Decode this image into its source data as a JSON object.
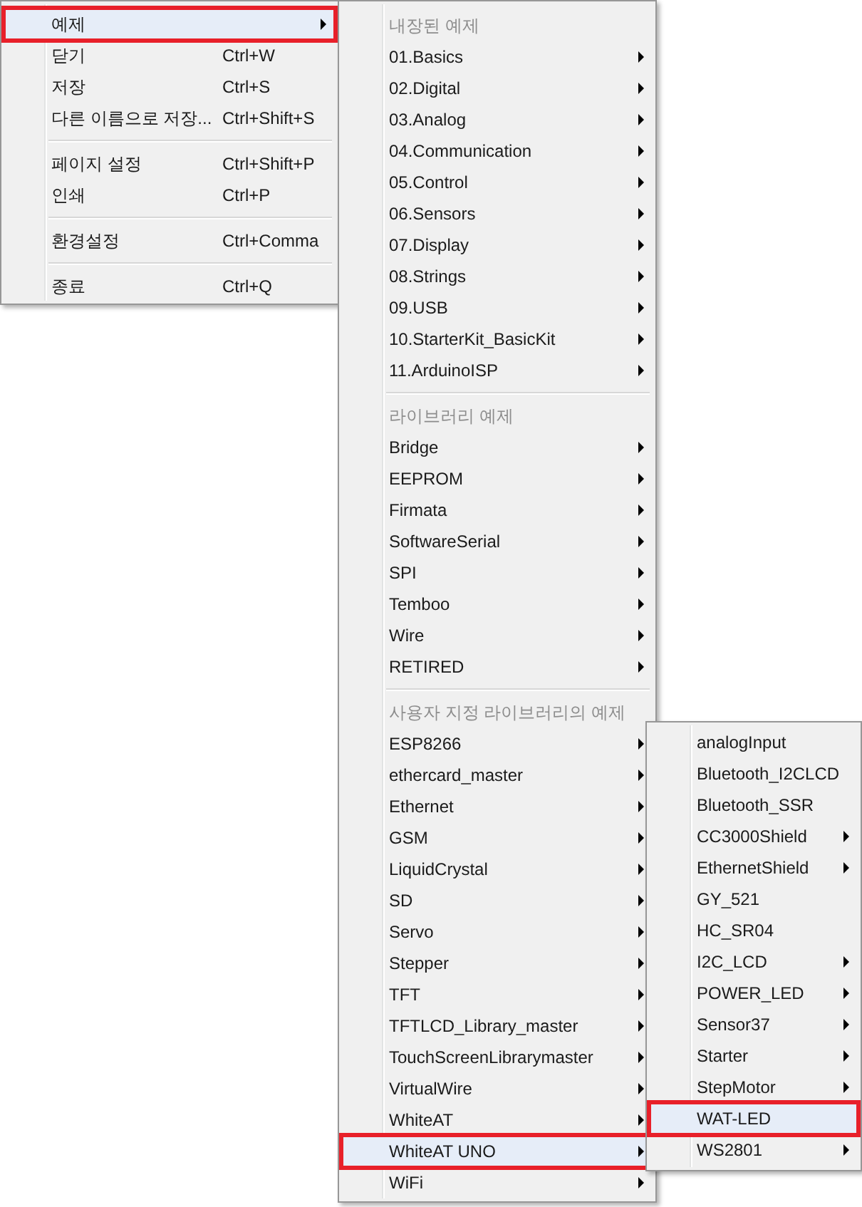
{
  "menus": [
    {
      "items": [
        {
          "kind": "item",
          "label": "예제",
          "submenu": true,
          "selected": true
        },
        {
          "kind": "item",
          "label": "닫기",
          "shortcut": "Ctrl+W",
          "selected": false
        },
        {
          "kind": "item",
          "label": "저장",
          "shortcut": "Ctrl+S",
          "selected": false
        },
        {
          "kind": "item",
          "label": "다른 이름으로 저장...",
          "shortcut": "Ctrl+Shift+S",
          "selected": false
        },
        {
          "kind": "separator"
        },
        {
          "kind": "item",
          "label": "페이지 설정",
          "shortcut": "Ctrl+Shift+P",
          "selected": false
        },
        {
          "kind": "item",
          "label": "인쇄",
          "shortcut": "Ctrl+P",
          "selected": false
        },
        {
          "kind": "separator"
        },
        {
          "kind": "item",
          "label": "환경설정",
          "shortcut": "Ctrl+Comma",
          "selected": false
        },
        {
          "kind": "separator"
        },
        {
          "kind": "item",
          "label": "종료",
          "shortcut": "Ctrl+Q",
          "selected": false
        }
      ]
    },
    {
      "items": [
        {
          "kind": "header",
          "label": "내장된 예제"
        },
        {
          "kind": "item",
          "label": "01.Basics",
          "submenu": true,
          "selected": false
        },
        {
          "kind": "item",
          "label": "02.Digital",
          "submenu": true,
          "selected": false
        },
        {
          "kind": "item",
          "label": "03.Analog",
          "submenu": true,
          "selected": false
        },
        {
          "kind": "item",
          "label": "04.Communication",
          "submenu": true,
          "selected": false
        },
        {
          "kind": "item",
          "label": "05.Control",
          "submenu": true,
          "selected": false
        },
        {
          "kind": "item",
          "label": "06.Sensors",
          "submenu": true,
          "selected": false
        },
        {
          "kind": "item",
          "label": "07.Display",
          "submenu": true,
          "selected": false
        },
        {
          "kind": "item",
          "label": "08.Strings",
          "submenu": true,
          "selected": false
        },
        {
          "kind": "item",
          "label": "09.USB",
          "submenu": true,
          "selected": false
        },
        {
          "kind": "item",
          "label": "10.StarterKit_BasicKit",
          "submenu": true,
          "selected": false
        },
        {
          "kind": "item",
          "label": "11.ArduinoISP",
          "submenu": true,
          "selected": false
        },
        {
          "kind": "separator"
        },
        {
          "kind": "header",
          "label": "라이브러리 예제"
        },
        {
          "kind": "item",
          "label": "Bridge",
          "submenu": true,
          "selected": false
        },
        {
          "kind": "item",
          "label": "EEPROM",
          "submenu": true,
          "selected": false
        },
        {
          "kind": "item",
          "label": "Firmata",
          "submenu": true,
          "selected": false
        },
        {
          "kind": "item",
          "label": "SoftwareSerial",
          "submenu": true,
          "selected": false
        },
        {
          "kind": "item",
          "label": "SPI",
          "submenu": true,
          "selected": false
        },
        {
          "kind": "item",
          "label": "Temboo",
          "submenu": true,
          "selected": false
        },
        {
          "kind": "item",
          "label": "Wire",
          "submenu": true,
          "selected": false
        },
        {
          "kind": "item",
          "label": "RETIRED",
          "submenu": true,
          "selected": false
        },
        {
          "kind": "separator"
        },
        {
          "kind": "header",
          "label": "사용자 지정 라이브러리의 예제"
        },
        {
          "kind": "item",
          "label": "ESP8266",
          "submenu": true,
          "selected": false
        },
        {
          "kind": "item",
          "label": "ethercard_master",
          "submenu": true,
          "selected": false
        },
        {
          "kind": "item",
          "label": "Ethernet",
          "submenu": true,
          "selected": false
        },
        {
          "kind": "item",
          "label": "GSM",
          "submenu": true,
          "selected": false
        },
        {
          "kind": "item",
          "label": "LiquidCrystal",
          "submenu": true,
          "selected": false
        },
        {
          "kind": "item",
          "label": "SD",
          "submenu": true,
          "selected": false
        },
        {
          "kind": "item",
          "label": "Servo",
          "submenu": true,
          "selected": false
        },
        {
          "kind": "item",
          "label": "Stepper",
          "submenu": true,
          "selected": false
        },
        {
          "kind": "item",
          "label": "TFT",
          "submenu": true,
          "selected": false
        },
        {
          "kind": "item",
          "label": "TFTLCD_Library_master",
          "submenu": true,
          "selected": false
        },
        {
          "kind": "item",
          "label": "TouchScreenLibrarymaster",
          "submenu": true,
          "selected": false
        },
        {
          "kind": "item",
          "label": "VirtualWire",
          "submenu": true,
          "selected": false
        },
        {
          "kind": "item",
          "label": "WhiteAT",
          "submenu": true,
          "selected": false
        },
        {
          "kind": "item",
          "label": "WhiteAT UNO",
          "submenu": true,
          "selected": true
        },
        {
          "kind": "item",
          "label": "WiFi",
          "submenu": true,
          "selected": false
        }
      ]
    },
    {
      "items": [
        {
          "kind": "item",
          "label": "analogInput",
          "submenu": false,
          "selected": false
        },
        {
          "kind": "item",
          "label": "Bluetooth_I2CLCD",
          "submenu": false,
          "selected": false
        },
        {
          "kind": "item",
          "label": "Bluetooth_SSR",
          "submenu": false,
          "selected": false
        },
        {
          "kind": "item",
          "label": "CC3000Shield",
          "submenu": true,
          "selected": false
        },
        {
          "kind": "item",
          "label": "EthernetShield",
          "submenu": true,
          "selected": false
        },
        {
          "kind": "item",
          "label": "GY_521",
          "submenu": false,
          "selected": false
        },
        {
          "kind": "item",
          "label": "HC_SR04",
          "submenu": false,
          "selected": false
        },
        {
          "kind": "item",
          "label": "I2C_LCD",
          "submenu": true,
          "selected": false
        },
        {
          "kind": "item",
          "label": "POWER_LED",
          "submenu": true,
          "selected": false
        },
        {
          "kind": "item",
          "label": "Sensor37",
          "submenu": true,
          "selected": false
        },
        {
          "kind": "item",
          "label": "Starter",
          "submenu": true,
          "selected": false
        },
        {
          "kind": "item",
          "label": "StepMotor",
          "submenu": true,
          "selected": false
        },
        {
          "kind": "item",
          "label": "WAT-LED",
          "submenu": false,
          "selected": true
        },
        {
          "kind": "item",
          "label": "WS2801",
          "submenu": true,
          "selected": false
        }
      ]
    }
  ]
}
